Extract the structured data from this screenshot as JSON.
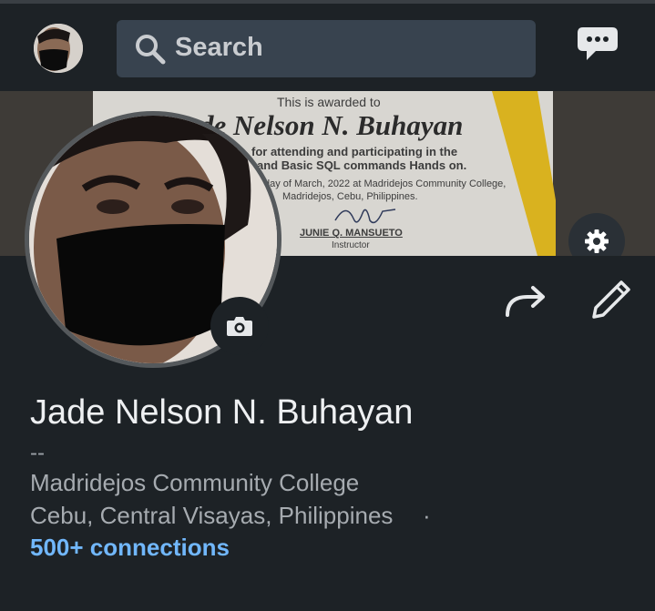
{
  "header": {
    "search_label": "Search",
    "icons": {
      "avatar": "user-avatar",
      "search": "search-icon",
      "messaging": "message-icon"
    }
  },
  "cover": {
    "certificate": {
      "line1": "This is awarded to",
      "name": "Jade Nelson N. Buhayan",
      "line3": "for attending and participating in the",
      "line4": "and Basic SQL commands Hands on.",
      "line5": "day of March, 2022 at Madridejos Community College,",
      "line6": "Madridejos, Cebu, Philippines.",
      "signatory": "JUNIE Q. MANSUETO",
      "role": "Instructor"
    },
    "icons": {
      "settings": "gear-icon",
      "camera": "camera-icon"
    }
  },
  "actions": {
    "icons": {
      "share": "share-icon",
      "edit": "pencil-icon"
    }
  },
  "profile": {
    "name": "Jade Nelson N. Buhayan",
    "headline": "--",
    "school": "Madridejos Community College",
    "location": "Cebu, Central Visayas, Philippines",
    "separator": "·",
    "connections": "500+ connections"
  },
  "colors": {
    "background": "#1d2226",
    "search_bg": "#38434f",
    "link": "#71b7fb",
    "text_primary": "#eef0f2",
    "text_secondary": "#a6abb0"
  }
}
